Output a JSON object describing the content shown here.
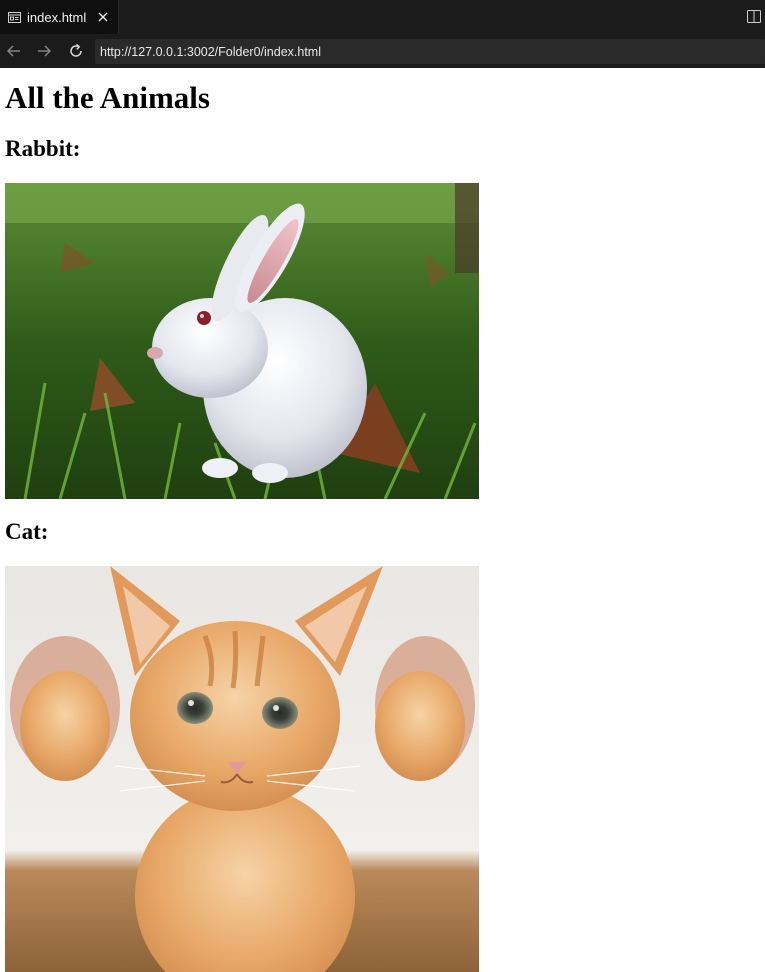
{
  "tab": {
    "title": "index.html"
  },
  "address_bar": {
    "url": "http://127.0.0.1:3002/Folder0/index.html"
  },
  "page": {
    "heading": "All the Animals",
    "sections": [
      {
        "label": "Rabbit:",
        "image_alt": "White rabbit sitting in green grass"
      },
      {
        "label": "Cat:",
        "image_alt": "Orange tabby kitten held up by its paws"
      }
    ]
  },
  "colors": {
    "chrome_bg": "#1b1b1b",
    "address_bg": "#2a2a2a",
    "page_bg": "#ffffff"
  },
  "icons": {
    "tab": "page-icon",
    "close": "close-icon",
    "split": "split-view-icon",
    "back": "back-arrow-icon",
    "forward": "forward-arrow-icon",
    "reload": "reload-icon"
  }
}
